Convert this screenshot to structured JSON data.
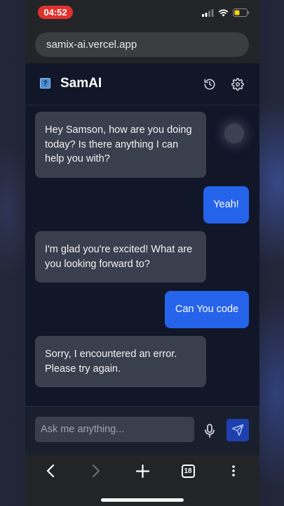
{
  "status": {
    "time": "04:52"
  },
  "browser": {
    "url": "samix-ai.vercel.app",
    "tab_count": "18"
  },
  "app": {
    "logo_glyph": "?",
    "title": "SamAI"
  },
  "messages": [
    {
      "role": "bot",
      "text": "Hey Samson, how are you doing today? Is there anything I can help you with?"
    },
    {
      "role": "user",
      "text": "Yeah!"
    },
    {
      "role": "bot",
      "text": "I'm glad you're excited! What are you looking forward to?"
    },
    {
      "role": "user",
      "text": "Can You code"
    },
    {
      "role": "bot",
      "text": "Sorry, I encountered an error. Please try again."
    }
  ],
  "composer": {
    "placeholder": "Ask me anything..."
  },
  "icons": {
    "history": "history-icon",
    "settings": "gear-icon",
    "mic": "microphone-icon",
    "send": "send-icon",
    "back": "chevron-left-icon",
    "forward": "chevron-right-icon",
    "new_tab": "plus-icon",
    "tabs": "tabs-icon",
    "more": "more-vertical-icon"
  },
  "colors": {
    "accent": "#2563eb",
    "bot_bubble": "#3a3f4e",
    "status_time": "#e0322d",
    "background": "#111729"
  }
}
